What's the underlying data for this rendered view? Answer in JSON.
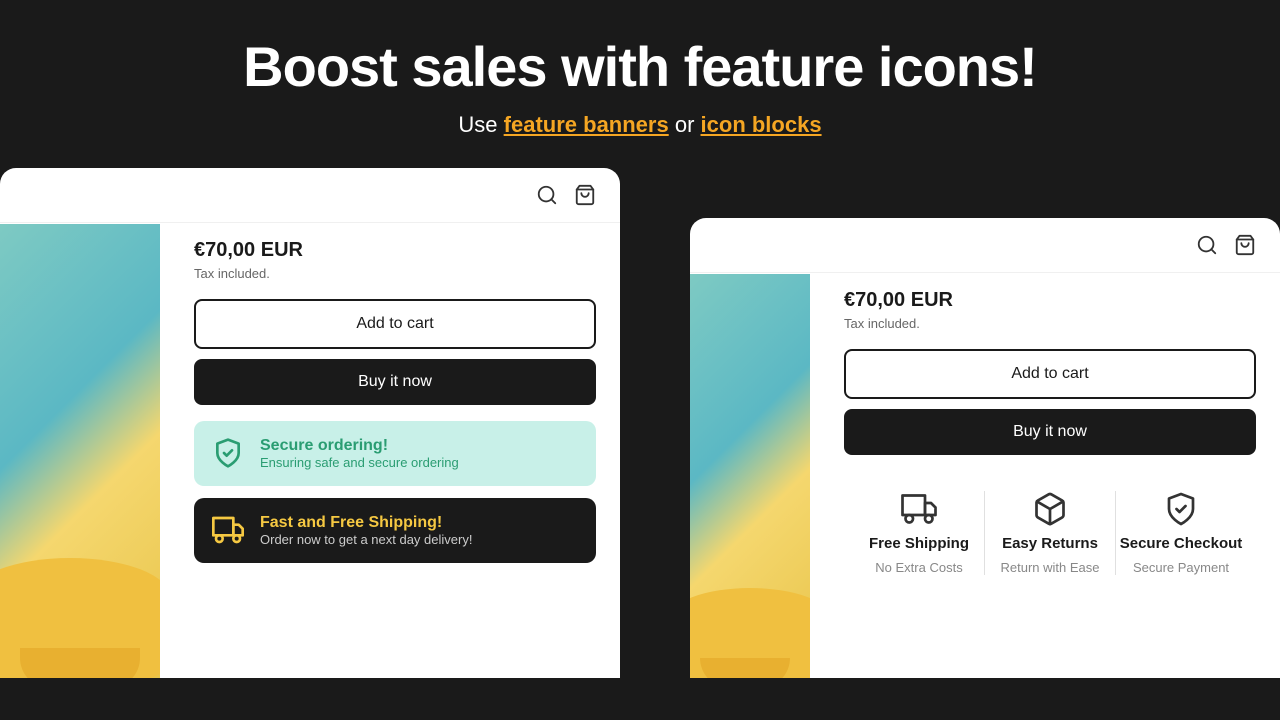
{
  "header": {
    "main_title": "Boost sales with feature icons!",
    "sub_title_prefix": "Use ",
    "link1_label": "feature banners",
    "sub_title_middle": " or ",
    "link2_label": "icon blocks"
  },
  "card_left": {
    "price": "€70,00 EUR",
    "tax": "Tax included.",
    "add_to_cart": "Add to cart",
    "buy_now": "Buy it now",
    "banner1_title": "Secure ordering!",
    "banner1_sub": "Ensuring safe and secure ordering",
    "banner2_title": "Fast and Free Shipping!",
    "banner2_sub": "Order now to get a next day delivery!"
  },
  "card_right": {
    "price": "€70,00 EUR",
    "tax": "Tax included.",
    "add_to_cart": "Add to cart",
    "buy_now": "Buy it now",
    "block1_title": "Free Shipping",
    "block1_sub": "No Extra Costs",
    "block2_title": "Easy Returns",
    "block2_sub": "Return with Ease",
    "block3_title": "Secure Checkout",
    "block3_sub": "Secure Payment"
  }
}
